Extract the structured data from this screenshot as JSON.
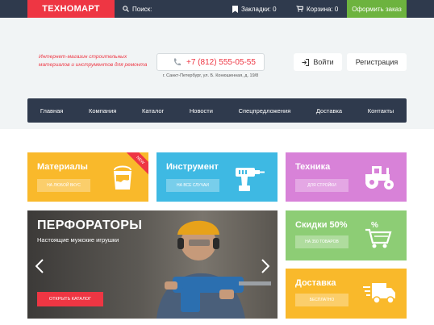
{
  "topbar": {
    "logo": "ТЕХНОМАРТ",
    "search_label": "Поиск:",
    "bookmarks": "Закладки: 0",
    "cart": "Корзина: 0",
    "order_button": "Оформить заказ"
  },
  "header": {
    "tagline": "Интернет-магазин строительных материалов и инструментов для ремонта",
    "phone": "+7 (812) 555-05-55",
    "address": "г. Санкт-Петербург, ул. Б. Конюшенная, д. 19/8",
    "login": "Войти",
    "register": "Регистрация"
  },
  "nav": [
    "Главная",
    "Компания",
    "Каталог",
    "Новости",
    "Спецпредложения",
    "Доставка",
    "Контакты"
  ],
  "tiles": {
    "materials": {
      "title": "Материалы",
      "button": "на любой вкус",
      "ribbon": "NEW"
    },
    "tools": {
      "title": "Инструмент",
      "button": "на все случаи"
    },
    "tech": {
      "title": "Техника",
      "button": "для стройки"
    },
    "sale": {
      "title": "Скидки 50%",
      "button": "на 350 товаров"
    },
    "delivery": {
      "title": "Доставка",
      "button": "бесплатно"
    }
  },
  "hero": {
    "title": "ПЕРФОРАТОРЫ",
    "subtitle": "Настоящие мужские игрушки",
    "button": "открыть каталог"
  },
  "colors": {
    "brand_red": "#ee3643",
    "dark_navy": "#2f3a4d",
    "green": "#6db33f",
    "yellow": "#f9b92b",
    "blue": "#3eb9e3",
    "violet": "#d882d8",
    "light_green": "#8dcd75"
  }
}
